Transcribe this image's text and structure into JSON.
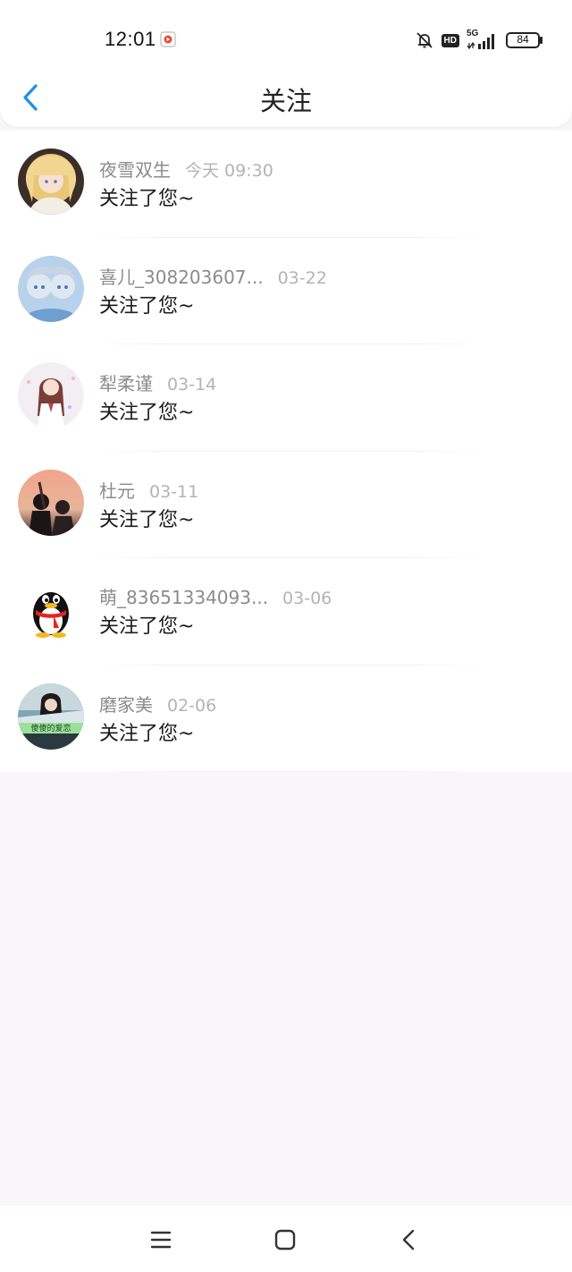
{
  "status_bar": {
    "time": "12:01",
    "network": "5G",
    "hd_badge": "HD",
    "battery": "84"
  },
  "header": {
    "title": "关注"
  },
  "items": [
    {
      "name": "夜雪双生",
      "date": "今天 09:30",
      "message": "关注了您~"
    },
    {
      "name": "喜儿_308203607...",
      "date": "03-22",
      "message": "关注了您~"
    },
    {
      "name": "犁柔谨",
      "date": "03-14",
      "message": "关注了您~"
    },
    {
      "name": "杜元",
      "date": "03-11",
      "message": "关注了您~"
    },
    {
      "name": "萌_83651334093...",
      "date": "03-06",
      "message": "关注了您~"
    },
    {
      "name": "磨家美",
      "date": "02-06",
      "message": "关注了您~"
    }
  ],
  "avatar_overlay_text": "傻傻的爱恋",
  "colors": {
    "accent": "#1e90e8",
    "name_gray": "#8b8b8b",
    "date_gray": "#b3b3b3",
    "page_bg": "#f8f6f8"
  }
}
